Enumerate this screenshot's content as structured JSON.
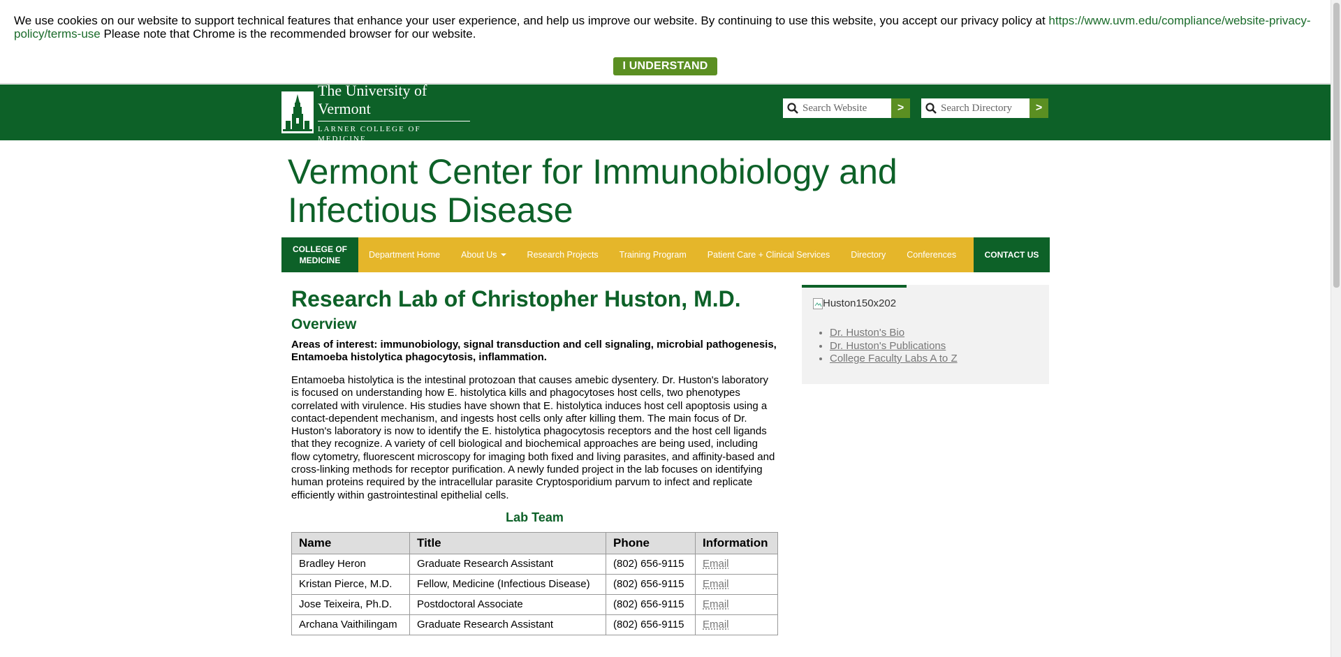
{
  "cookie": {
    "text": "We use cookies on our website to support technical features that enhance your user experience, and help us improve our website. By continuing to use this website, you accept our privacy policy at",
    "link": "https://www.uvm.edu/compliance/website-privacy-policy/terms-use",
    "note": "Please note that Chrome is the recommended browser for our website.",
    "button": "I UNDERSTAND"
  },
  "header": {
    "logo_line1": "The University of Vermont",
    "logo_line2": "LARNER COLLEGE OF MEDICINE",
    "search_website_placeholder": "Search Website",
    "search_directory_placeholder": "Search Directory",
    "go_label": ">"
  },
  "site_title": "Vermont Center for Immunobiology and Infectious Disease",
  "nav": {
    "college": "COLLEGE OF MEDICINE",
    "items": [
      "Department Home",
      "About Us",
      "Research Projects",
      "Training Program",
      "Patient Care + Clinical Services",
      "Directory",
      "Conferences"
    ],
    "contact": "CONTACT US"
  },
  "main": {
    "title": "Research Lab of Christopher Huston, M.D.",
    "overview": "Overview",
    "interest": "Areas of interest: immunobiology, signal transduction and cell signaling, microbial pathogenesis, Entamoeba histolytica phagocytosis, inflammation.",
    "body": "Entamoeba histolytica is the intestinal protozoan that causes amebic dysentery. Dr. Huston's laboratory is focused on understanding how E. histolytica kills and phagocytoses host cells, two phenotypes correlated with virulence. His studies have shown that E. histolytica induces host cell apoptosis using a contact-dependent mechanism, and ingests host cells only after killing them. The main focus of Dr. Huston's laboratory is now to identify the E. histolytica phagocytosis receptors and the host cell ligands that they recognize. A variety of cell biological and biochemical approaches are being used, including flow cytometry, fluorescent microscopy for imaging both fixed and living parasites, and affinity-based and cross-linking methods for receptor purification. A newly funded project in the lab focuses on identifying human proteins required by the intracellular parasite Cryptosporidium parvum to infect and replicate efficiently within gastrointestinal epithelial cells.",
    "lab_team": "Lab Team",
    "table": {
      "headers": [
        "Name",
        "Title",
        "Phone",
        "Information"
      ],
      "rows": [
        [
          "Bradley Heron",
          "Graduate Research Assistant",
          "(802) 656-9115",
          "Email"
        ],
        [
          "Kristan Pierce, M.D.",
          "Fellow, Medicine (Infectious Disease)",
          "(802) 656-9115",
          "Email"
        ],
        [
          "Jose Teixeira, Ph.D.",
          "Postdoctoral Associate",
          "(802) 656-9115",
          "Email"
        ],
        [
          "Archana Vaithilingam",
          "Graduate Research Assistant",
          "(802) 656-9115",
          "Email"
        ]
      ]
    }
  },
  "sidebar": {
    "image_alt": "Huston150x202",
    "links": [
      "Dr. Huston's Bio",
      "Dr. Huston's Publications",
      "College Faculty Labs A to Z"
    ]
  },
  "colors": {
    "brand_green": "#0d6128",
    "nav_gold": "#e5b62a",
    "accent_green": "#5b8f22"
  }
}
